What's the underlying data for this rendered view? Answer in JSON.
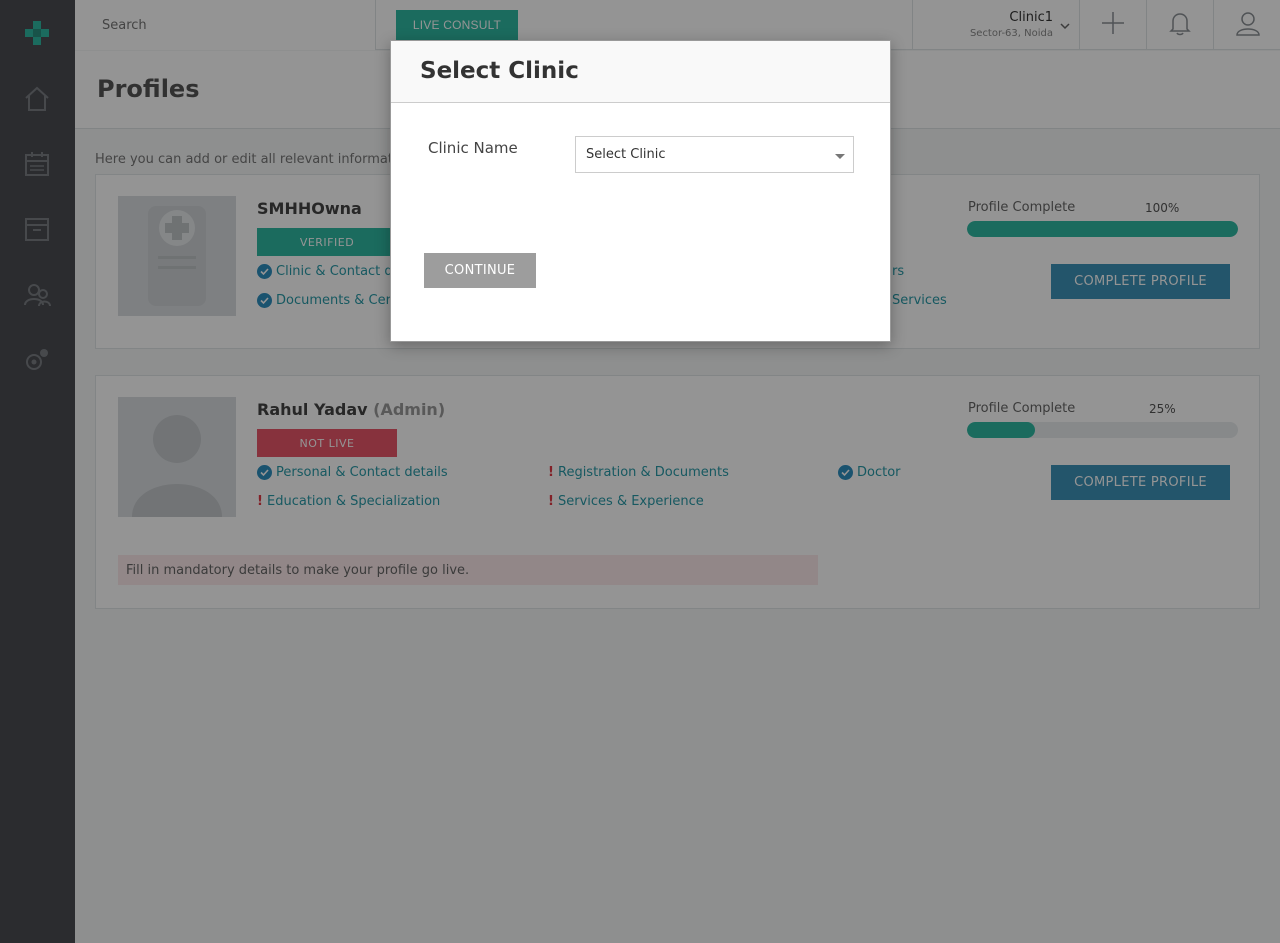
{
  "topbar": {
    "search_placeholder": "Search",
    "live_consult_label": "LIVE CONSULT",
    "clinic_name": "Clinic1",
    "clinic_location": "Sector-63, Noida"
  },
  "page": {
    "title": "Profiles",
    "intro": "Here you can add or edit all relevant information"
  },
  "cards": [
    {
      "name": "SMHHOwna",
      "role": "",
      "status": "VERIFIED",
      "status_color": "#2fb9a3",
      "links": [
        {
          "label": "Clinic & Contact de",
          "state": "complete"
        },
        {
          "label": "Documents & Certi",
          "state": "complete"
        },
        {
          "label": "rs",
          "state": "complete"
        },
        {
          "label": "Services",
          "state": "complete"
        }
      ],
      "progress_label": "Profile Complete",
      "progress_text": "100%",
      "progress_value": 100,
      "button": "COMPLETE PROFILE"
    },
    {
      "name": "Rahul Yadav",
      "role": "(Admin)",
      "status": "NOT LIVE",
      "status_color": "#e8566a",
      "links": [
        {
          "label": "Personal & Contact details",
          "state": "complete"
        },
        {
          "label": "Registration & Documents",
          "state": "incomplete"
        },
        {
          "label": "Doctor",
          "state": "complete"
        },
        {
          "label": "Education & Specialization",
          "state": "incomplete"
        },
        {
          "label": "Services & Experience",
          "state": "incomplete"
        }
      ],
      "progress_label": "Profile Complete",
      "progress_text": "25%",
      "progress_value": 25,
      "button": "COMPLETE PROFILE",
      "notice": "Fill in mandatory details to make your profile go live."
    }
  ],
  "modal": {
    "title": "Select Clinic",
    "field_label": "Clinic Name",
    "select_value": "Select Clinic",
    "continue_label": "CONTINUE"
  },
  "colors": {
    "accent_green": "#2fb9a3",
    "accent_blue": "#3d93b8",
    "link_teal": "#2899a7",
    "danger": "#e03a46"
  },
  "icons": [
    "logo-cross-icon",
    "home-icon",
    "calendar-icon",
    "archive-icon",
    "users-icon",
    "settings-icon",
    "plus-icon",
    "bell-icon",
    "user-icon",
    "chevron-down-icon",
    "check-circle-icon"
  ]
}
